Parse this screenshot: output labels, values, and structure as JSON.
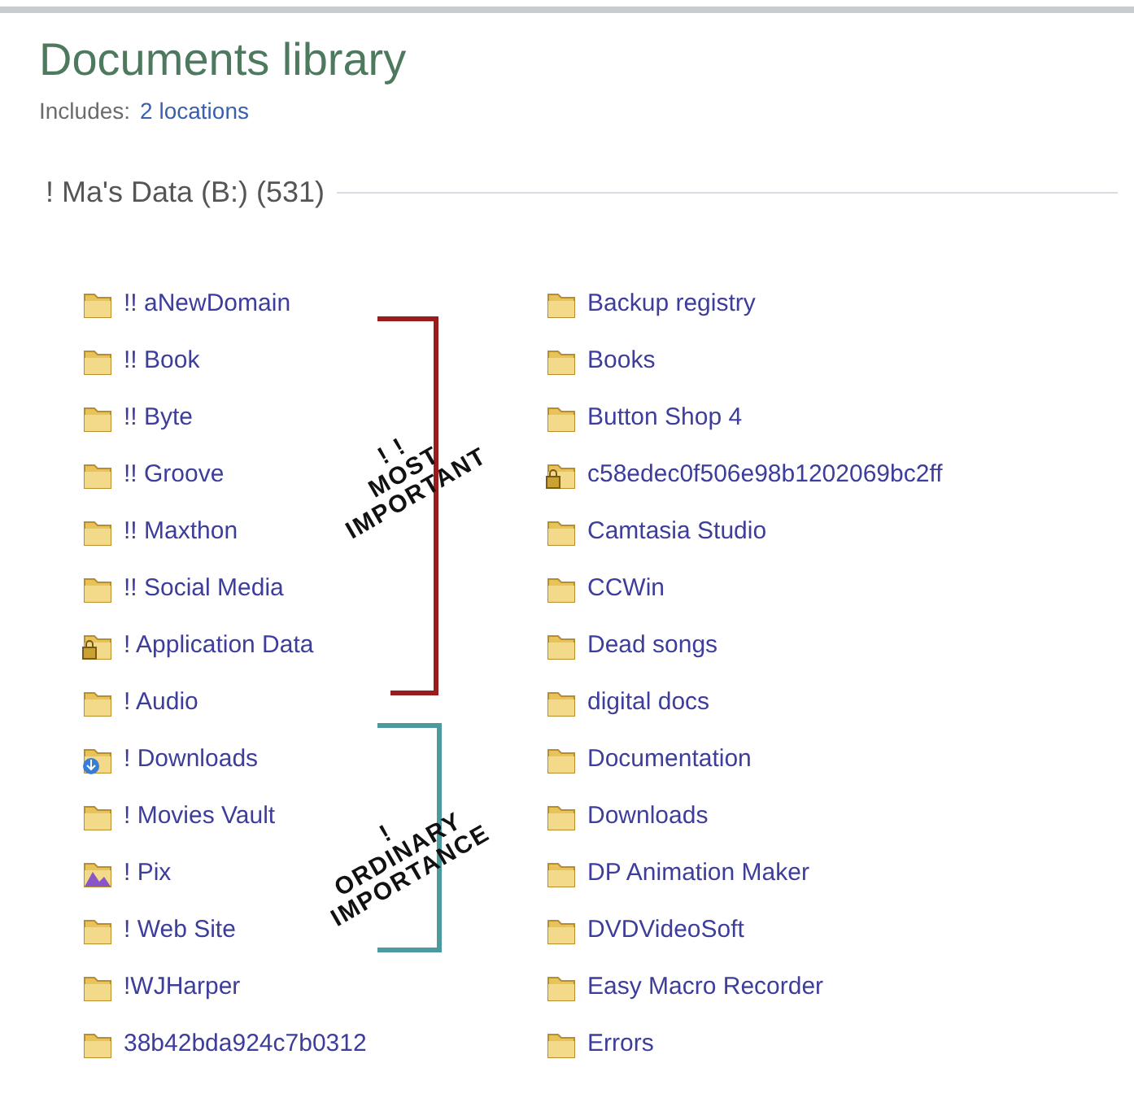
{
  "library": {
    "title": "Documents library",
    "includes_label": "Includes:",
    "includes_link": "2 locations"
  },
  "group": {
    "header": "! Ma's Data (B:) (531)"
  },
  "columns": [
    [
      {
        "name": "!! aNewDomain",
        "kind": "folder"
      },
      {
        "name": "!! Book",
        "kind": "folder"
      },
      {
        "name": "!! Byte",
        "kind": "folder"
      },
      {
        "name": "!! Groove",
        "kind": "folder"
      },
      {
        "name": "!! Maxthon",
        "kind": "folder"
      },
      {
        "name": "!! Social Media",
        "kind": "folder"
      },
      {
        "name": "! Application Data",
        "kind": "locked"
      },
      {
        "name": "! Audio",
        "kind": "folder"
      },
      {
        "name": "! Downloads",
        "kind": "downloads"
      },
      {
        "name": "! Movies Vault",
        "kind": "folder"
      },
      {
        "name": "! Pix",
        "kind": "pictures"
      },
      {
        "name": "! Web Site",
        "kind": "folder"
      },
      {
        "name": "!WJHarper",
        "kind": "folder"
      },
      {
        "name": "38b42bda924c7b0312",
        "kind": "folder"
      }
    ],
    [
      {
        "name": "Backup registry",
        "kind": "folder"
      },
      {
        "name": "Books",
        "kind": "folder"
      },
      {
        "name": "Button Shop 4",
        "kind": "folder"
      },
      {
        "name": "c58edec0f506e98b1202069bc2ff",
        "kind": "locked"
      },
      {
        "name": "Camtasia Studio",
        "kind": "folder"
      },
      {
        "name": "CCWin",
        "kind": "folder"
      },
      {
        "name": "Dead songs",
        "kind": "folder"
      },
      {
        "name": "digital docs",
        "kind": "folder"
      },
      {
        "name": "Documentation",
        "kind": "folder"
      },
      {
        "name": "Downloads",
        "kind": "folder"
      },
      {
        "name": "DP Animation Maker",
        "kind": "folder"
      },
      {
        "name": "DVDVideoSoft",
        "kind": "folder"
      },
      {
        "name": "Easy Macro Recorder",
        "kind": "folder"
      },
      {
        "name": "Errors",
        "kind": "folder"
      }
    ]
  ],
  "annotations": [
    {
      "lines": [
        "! !",
        "MOST",
        "IMPORTANT"
      ],
      "color": "#9b1c1c"
    },
    {
      "lines": [
        "!",
        "ORDINARY",
        "IMPORTANCE"
      ],
      "color": "#4a9aa0"
    }
  ]
}
